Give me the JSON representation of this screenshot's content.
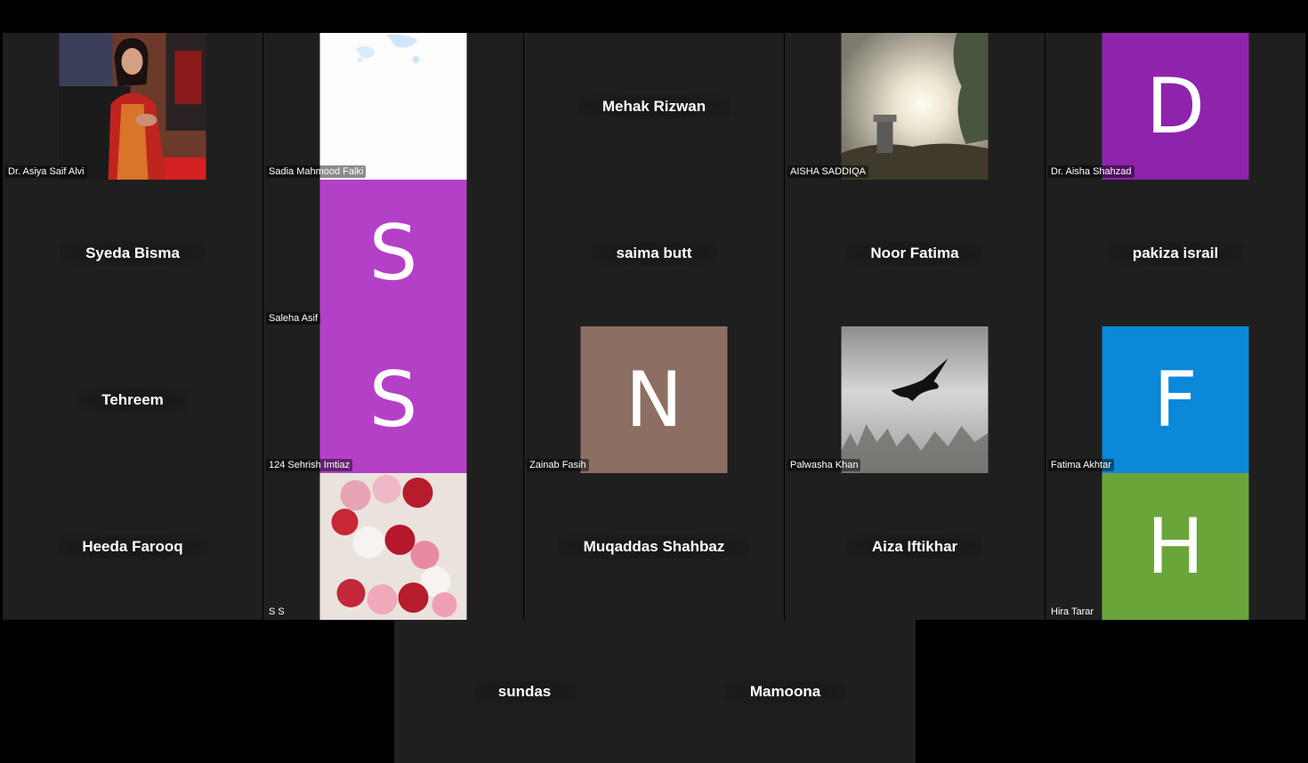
{
  "colors": {
    "tile_bg": "#1f1f1f",
    "avatar_purple_dark": "#8e24aa",
    "avatar_purple": "#b440c8",
    "avatar_taupe": "#8d6e63",
    "avatar_blue": "#0b88d8",
    "avatar_green": "#6aa539"
  },
  "participants": [
    {
      "name": "Dr. Asiya Saif Alvi",
      "kind": "photo",
      "image": "person-photo"
    },
    {
      "name": "Sadia Mahmood Falki",
      "kind": "photo",
      "image": "light-map-image"
    },
    {
      "name": "Mehak Rizwan",
      "kind": "name"
    },
    {
      "name": "AISHA SADDIQA",
      "kind": "photo",
      "image": "sunset-landscape-photo"
    },
    {
      "name": "Dr. Aisha Shahzad",
      "kind": "avatar",
      "initial": "D",
      "color": "#8e24aa"
    },
    {
      "name": "Syeda Bisma",
      "kind": "name"
    },
    {
      "name": "Saleha Asif",
      "kind": "avatar",
      "initial": "S",
      "color": "#b440c8"
    },
    {
      "name": "saima butt",
      "kind": "name"
    },
    {
      "name": "Noor Fatima",
      "kind": "name"
    },
    {
      "name": "pakiza israil",
      "kind": "name"
    },
    {
      "name": "Tehreem",
      "kind": "name"
    },
    {
      "name": "124 Sehrish Imtiaz",
      "kind": "avatar",
      "initial": "S",
      "color": "#b440c8"
    },
    {
      "name": "Zainab Fasih",
      "kind": "avatar",
      "initial": "N",
      "color": "#8d6e63"
    },
    {
      "name": "Palwasha Khan",
      "kind": "photo",
      "image": "eagle-fog-photo"
    },
    {
      "name": "Fatima Akhtar",
      "kind": "avatar",
      "initial": "F",
      "color": "#0b88d8"
    },
    {
      "name": "Heeda Farooq",
      "kind": "name"
    },
    {
      "name": "S S",
      "kind": "photo",
      "image": "rose-letter-s-photo"
    },
    {
      "name": "Muqaddas Shahbaz",
      "kind": "name"
    },
    {
      "name": "Aiza Iftikhar",
      "kind": "name"
    },
    {
      "name": "Hira Tarar",
      "kind": "avatar",
      "initial": "H",
      "color": "#6aa539"
    },
    {
      "name": "sundas",
      "kind": "name"
    },
    {
      "name": "Mamoona",
      "kind": "name"
    }
  ]
}
